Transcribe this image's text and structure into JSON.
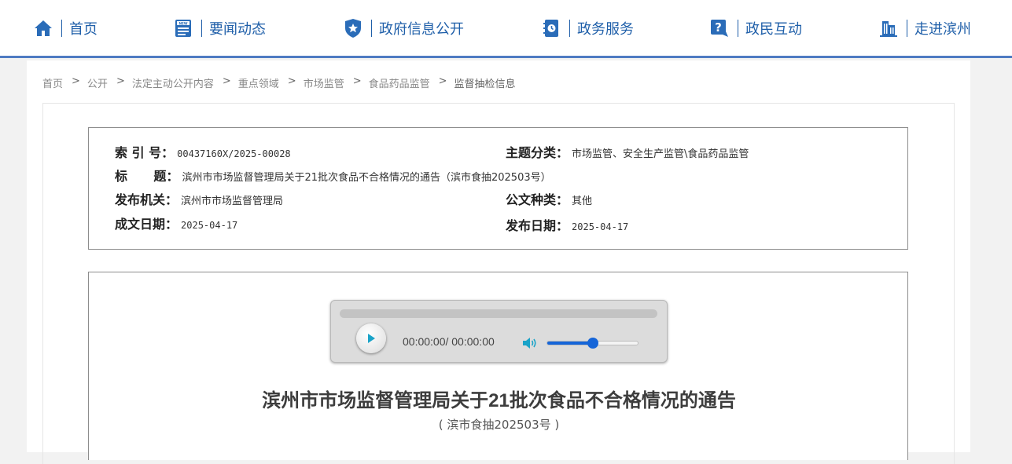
{
  "nav": {
    "items": [
      {
        "label": "首页",
        "icon": "home-icon"
      },
      {
        "label": "要闻动态",
        "icon": "news-icon"
      },
      {
        "label": "政府信息公开",
        "icon": "badge-star-icon"
      },
      {
        "label": "政务服务",
        "icon": "service-icon"
      },
      {
        "label": "政民互动",
        "icon": "question-icon"
      },
      {
        "label": "走进滨州",
        "icon": "building-icon"
      }
    ],
    "color": "#1f5fa9",
    "border_color": "#4f7bc2"
  },
  "breadcrumb": {
    "items": [
      "首页",
      "公开",
      "法定主动公开内容",
      "重点领域",
      "市场监管",
      "食品药品监管",
      "监督抽检信息"
    ],
    "separator": ">"
  },
  "meta": {
    "index_label": "索 引 号：",
    "index_value": "00437160X/2025-00028",
    "topic_label": "主题分类：",
    "topic_value": "市场监管、安全生产监管\\食品药品监管",
    "title_label": "标      题：",
    "title_value": "滨州市市场监督管理局关于21批次食品不合格情况的通告（滨市食抽202503号）",
    "org_label": "发布机关：",
    "org_value": "滨州市市场监督管理局",
    "doctype_label": "公文种类：",
    "doctype_value": "其他",
    "created_label": "成文日期：",
    "created_value": "2025-04-17",
    "published_label": "发布日期：",
    "published_value": "2025-04-17"
  },
  "player": {
    "time": "00:00:00/ 00:00:00",
    "progress": 0,
    "volume": 0.5,
    "accent": "#1565d8"
  },
  "article": {
    "title": "滨州市市场监督管理局关于21批次食品不合格情况的通告",
    "subtitle": "( 滨市食抽202503号 )"
  }
}
